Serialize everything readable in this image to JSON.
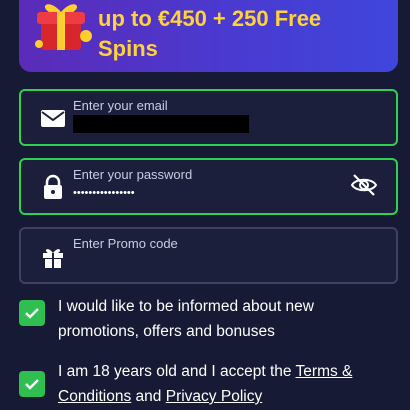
{
  "banner": {
    "line1": "up to €450 + 250 Free",
    "line2": "Spins"
  },
  "email": {
    "label": "Enter your email",
    "value": ""
  },
  "password": {
    "label": "Enter your password",
    "value": "••••••••••••••••"
  },
  "promo": {
    "label": "Enter Promo code"
  },
  "consent": {
    "marketing_text": "I would like to be informed about new promotions, offers and bonuses",
    "age_prefix": "I am 18 years old and I accept the ",
    "terms_link": "Terms & Conditions",
    "and_text": " and ",
    "privacy_link": "Privacy Policy"
  },
  "colors": {
    "background": "#161a35",
    "accent_green": "#2fd24e",
    "banner_text": "#ffd23a"
  },
  "icons": [
    "gift-box-icon",
    "envelope-icon",
    "lock-icon",
    "eye-slash-icon",
    "gift-icon",
    "checkmark-icon"
  ]
}
